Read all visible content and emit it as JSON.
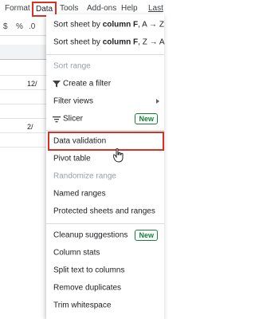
{
  "menubar": {
    "format": "Format",
    "data": "Data",
    "tools": "Tools",
    "addons": "Add-ons",
    "help": "Help",
    "last": "Last"
  },
  "sheet": {
    "toolbar": [
      "$",
      "%",
      ".0"
    ],
    "cells": [
      "12/",
      "2/"
    ]
  },
  "menu": {
    "sort_az_prefix": "Sort sheet by ",
    "sort_az_col": "column F",
    "sort_az_suffix": ", A → Z",
    "sort_za_prefix": "Sort sheet by ",
    "sort_za_col": "column F",
    "sort_za_suffix": ", Z → A",
    "sort_range": "Sort range",
    "create_filter": "Create a filter",
    "filter_views": "Filter views",
    "slicer": "Slicer",
    "slicer_badge": "New",
    "data_validation": "Data validation",
    "pivot_table": "Pivot table",
    "randomize_range": "Randomize range",
    "named_ranges": "Named ranges",
    "protected": "Protected sheets and ranges",
    "cleanup": "Cleanup suggestions",
    "cleanup_badge": "New",
    "column_stats": "Column stats",
    "split_text": "Split text to columns",
    "remove_duplicates": "Remove duplicates",
    "trim_whitespace": "Trim whitespace"
  },
  "colors": {
    "highlight": "#d93025",
    "badge": "#188038",
    "disabled": "#9aa0a6"
  }
}
